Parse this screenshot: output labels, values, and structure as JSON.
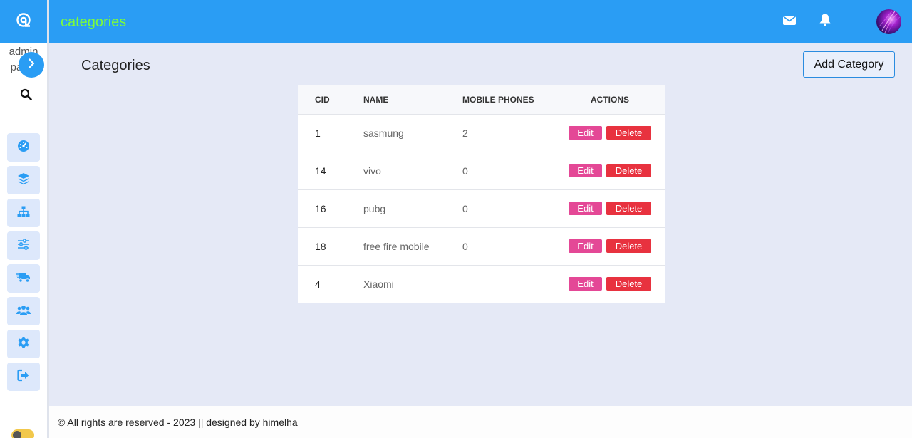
{
  "brand": {
    "line1": "admin",
    "line2": "panel"
  },
  "header": {
    "title": "categories"
  },
  "icons": {
    "logo": "at-logo-icon",
    "toggle": "chevron-right-icon",
    "search": "search-icon",
    "mail": "envelope-icon",
    "bell": "bell-icon"
  },
  "sidebar": {
    "items": [
      {
        "icon": "dashboard-gauge-icon"
      },
      {
        "icon": "layers-icon"
      },
      {
        "icon": "sitemap-icon"
      },
      {
        "icon": "sliders-icon"
      },
      {
        "icon": "delivery-truck-icon"
      },
      {
        "icon": "users-icon"
      },
      {
        "icon": "gear-icon"
      },
      {
        "icon": "sign-out-icon"
      }
    ]
  },
  "main": {
    "page_title": "Categories",
    "add_button": "Add Category"
  },
  "table": {
    "headers": {
      "cid": "CID",
      "name": "NAME",
      "mobile_phones": "MOBILE PHONES",
      "actions": "ACTIONS"
    },
    "rows": [
      {
        "cid": "1",
        "name": "sasmung",
        "mobile_phones": "2",
        "edit": "Edit",
        "delete": "Delete"
      },
      {
        "cid": "14",
        "name": "vivo",
        "mobile_phones": "0",
        "edit": "Edit",
        "delete": "Delete"
      },
      {
        "cid": "16",
        "name": "pubg",
        "mobile_phones": "0",
        "edit": "Edit",
        "delete": "Delete"
      },
      {
        "cid": "18",
        "name": "free fire mobile",
        "mobile_phones": "0",
        "edit": "Edit",
        "delete": "Delete"
      },
      {
        "cid": "4",
        "name": "Xiaomi",
        "mobile_phones": "",
        "edit": "Edit",
        "delete": "Delete"
      }
    ]
  },
  "footer": {
    "text": "© All rights are reserved - 2023 || designed by himelha"
  },
  "colors": {
    "primary": "#2a9df4",
    "title_accent": "#7dfc3a",
    "edit": "#e44896",
    "delete": "#e8323f",
    "background": "#e5e9f6"
  }
}
